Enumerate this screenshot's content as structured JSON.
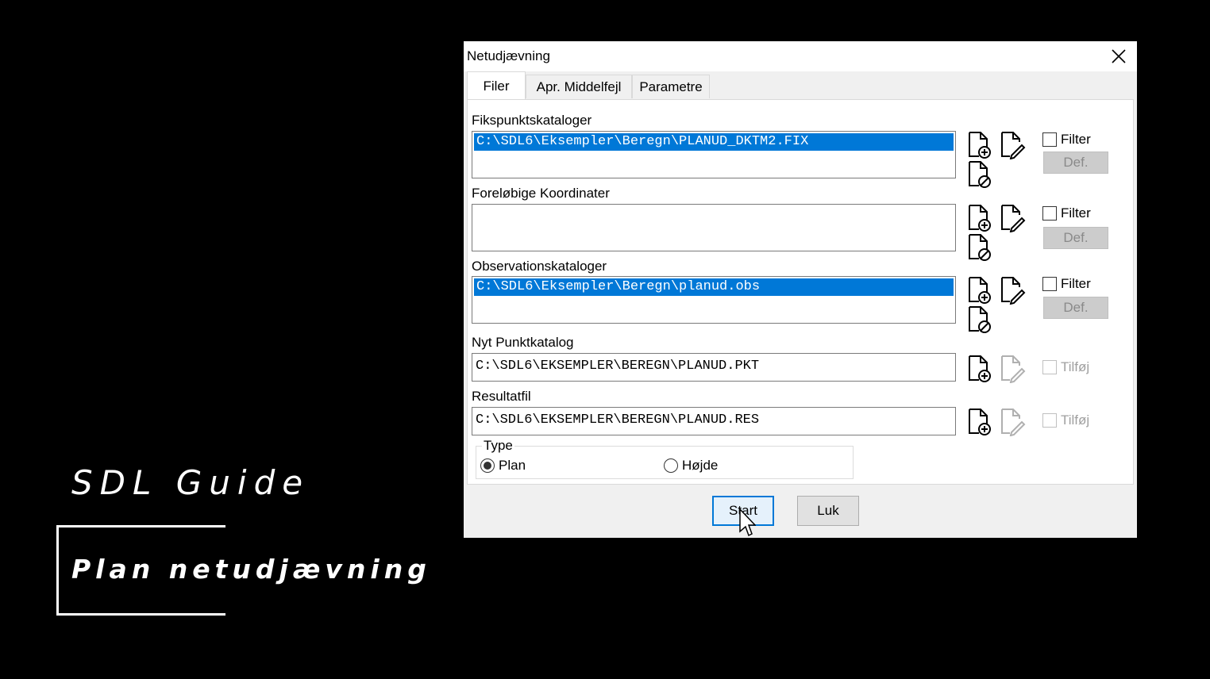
{
  "overlay": {
    "title": "SDL Guide",
    "subtitle": "Plan netudjævning"
  },
  "dialog": {
    "title": "Netudjævning",
    "tabs": [
      {
        "label": "Filer",
        "active": true
      },
      {
        "label": "Apr. Middelfejl",
        "active": false
      },
      {
        "label": "Parametre",
        "active": false
      }
    ],
    "sections": {
      "fix": {
        "label": "Fikspunktskataloger",
        "selected_item": "C:\\SDL6\\Eksempler\\Beregn\\PLANUD_DKTM2.FIX",
        "filter_label": "Filter",
        "def_label": "Def."
      },
      "prelim": {
        "label": "Foreløbige Koordinater",
        "selected_item": "",
        "filter_label": "Filter",
        "def_label": "Def."
      },
      "obs": {
        "label": "Observationskataloger",
        "selected_item": "C:\\SDL6\\Eksempler\\Beregn\\planud.obs",
        "filter_label": "Filter",
        "def_label": "Def."
      },
      "newpoint": {
        "label": "Nyt Punktkatalog",
        "value": "C:\\SDL6\\EKSEMPLER\\BEREGN\\PLANUD.PKT",
        "append_label": "Tilføj"
      },
      "result": {
        "label": "Resultatfil",
        "value": "C:\\SDL6\\EKSEMPLER\\BEREGN\\PLANUD.RES",
        "append_label": "Tilføj"
      }
    },
    "type": {
      "legend": "Type",
      "options": [
        {
          "label": "Plan",
          "selected": true
        },
        {
          "label": "Højde",
          "selected": false
        }
      ]
    },
    "buttons": {
      "start": "Start",
      "close": "Luk"
    }
  },
  "colors": {
    "selection": "#0078d7",
    "dialog_bg": "#f0f0f0",
    "page_bg": "#000000"
  }
}
